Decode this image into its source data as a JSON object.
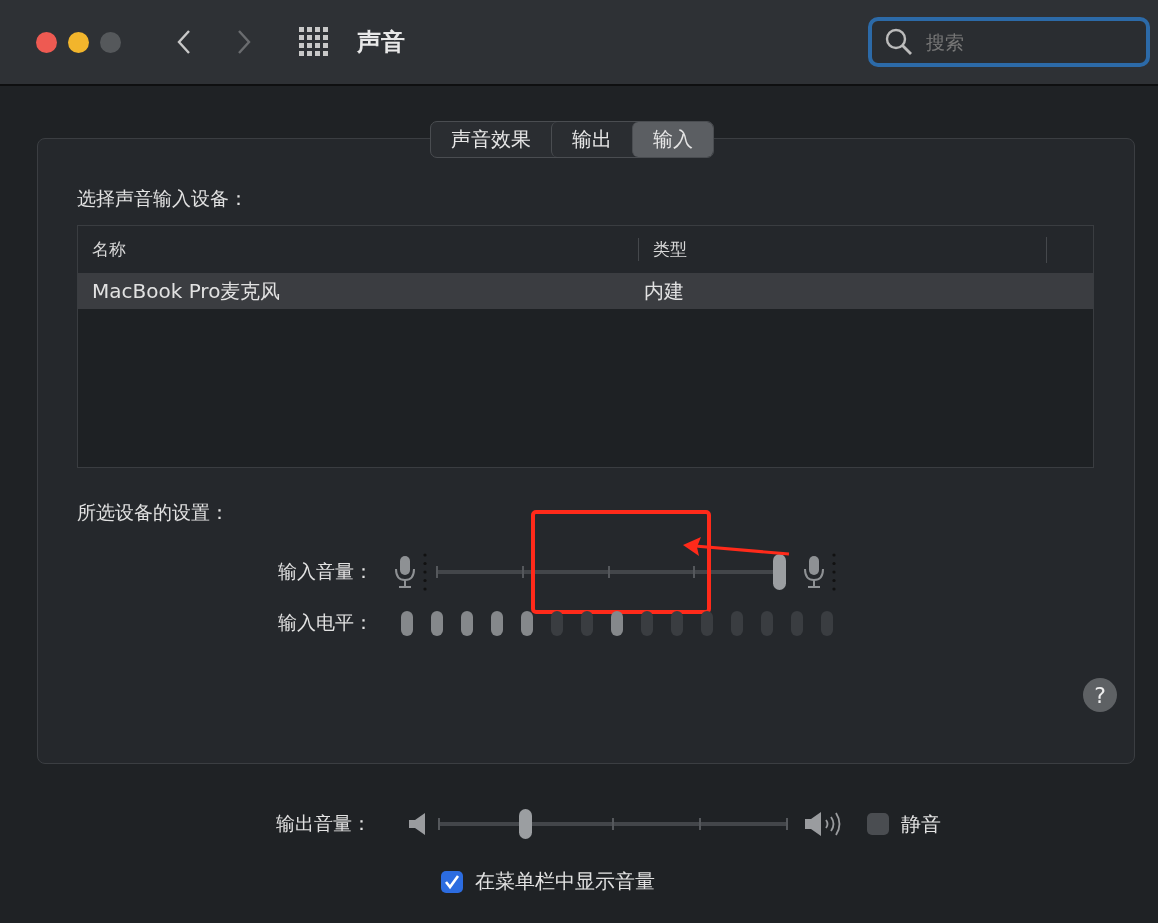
{
  "window": {
    "title": "声音"
  },
  "search": {
    "placeholder": "搜索"
  },
  "tabs": [
    {
      "label": "声音效果",
      "selected": false
    },
    {
      "label": "输出",
      "selected": false
    },
    {
      "label": "输入",
      "selected": true
    }
  ],
  "device_section": {
    "heading": "选择声音输入设备：",
    "columns": [
      "名称",
      "类型"
    ],
    "rows": [
      {
        "name": "MacBook Pro麦克风",
        "type": "内建",
        "selected": true
      }
    ]
  },
  "settings": {
    "heading": "所选设备的设置：",
    "input_volume": {
      "label": "输入音量：",
      "level": 1.0
    },
    "input_level": {
      "label": "输入电平：",
      "segments": [
        {
          "on": true
        },
        {
          "on": true
        },
        {
          "on": true
        },
        {
          "on": true
        },
        {
          "on": true
        },
        {
          "on": false
        },
        {
          "on": false
        },
        {
          "on": true
        },
        {
          "on": false
        },
        {
          "on": false
        },
        {
          "on": false
        },
        {
          "on": false
        },
        {
          "on": false
        },
        {
          "on": false
        },
        {
          "on": false
        }
      ]
    }
  },
  "output_volume": {
    "label": "输出音量：",
    "level": 0.25
  },
  "mute": {
    "label": "静音",
    "checked": false
  },
  "show_in_menu_bar": {
    "label": "在菜单栏中显示音量",
    "checked": true
  },
  "help": {
    "label": "?"
  }
}
